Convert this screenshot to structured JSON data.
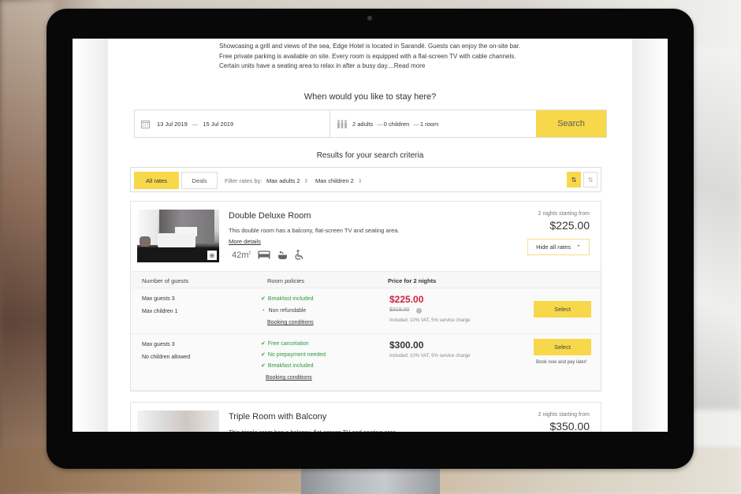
{
  "hotel": {
    "description": "Showcasing a grill and views of the sea, Edge Hotel is located in Sarandë. Guests can enjoy the on-site bar. Free private parking is available on site. Every room is equipped with a flat-screen TV with cable channels. Certain units have a seating area to relax in after a busy day....",
    "read_more": "Read more"
  },
  "search": {
    "title": "When would you like to stay here?",
    "checkin": "13 Jul 2019",
    "checkout": "15 Jul 2019",
    "adults": "2 adults",
    "children": "0 children",
    "rooms": "1 room",
    "search_label": "Search",
    "calendar_icon": "calendar-icon",
    "guests_icon": "people-icon"
  },
  "results": {
    "title": "Results for your search criteria",
    "tabs": [
      {
        "label": "All rates",
        "active": true
      },
      {
        "label": "Deals",
        "active": false
      }
    ],
    "filter_label": "Filter rates by:",
    "max_adults": "Max adults 2",
    "max_children": "Max children 2",
    "sort_icons": [
      "sort-active-icon",
      "sort-icon"
    ]
  },
  "rooms": [
    {
      "name": "Double Deluxe Room",
      "description": "This double room has a balcony, flat-screen TV and seating area.",
      "more_details": "More details",
      "area": "42m",
      "area_unit_sup": "2",
      "amenities": [
        "bed-icon",
        "bathtub-icon",
        "wheelchair-icon"
      ],
      "starting_label": "2 nights starting from",
      "starting_price": "$225.00",
      "hide_rates": "Hide all rates",
      "rates_header": {
        "guests": "Number of guests",
        "policies": "Room policies",
        "price": "Price for 2 nights"
      },
      "rates": [
        {
          "guests": [
            "Max guests 3",
            "Max children 1"
          ],
          "policies": [
            {
              "text": "Breakfast included",
              "type": "check"
            },
            {
              "text": "Non refundable",
              "type": "bullet"
            }
          ],
          "booking_conditions": "Booking conditions",
          "price": "$225.00",
          "old_price": "$319.00",
          "included": "Included: 10% VAT,  5% service charge",
          "select": "Select",
          "note": ""
        },
        {
          "guests": [
            "Max guests 3",
            "No children allowed"
          ],
          "policies": [
            {
              "text": "Free cancelation",
              "type": "check"
            },
            {
              "text": "No prepayment needed",
              "type": "check"
            },
            {
              "text": "Breakfast included",
              "type": "check"
            }
          ],
          "booking_conditions": "Booking conditions",
          "price": "$300.00",
          "old_price": "",
          "included": "Included: 10% VAT,  5% service charge",
          "select": "Select",
          "note": "Book now and pay later!"
        }
      ]
    },
    {
      "name": "Triple Room with Balcony",
      "description": "This tripple room has a balcony, flat-screen TV and seating area.",
      "starting_label": "2 nights starting from",
      "starting_price": "$350.00"
    }
  ],
  "colors": {
    "accent": "#f7d84a",
    "sale_price": "#d0213e",
    "policy_green": "#2e9a3e",
    "monitor_bezel": "#080808"
  }
}
